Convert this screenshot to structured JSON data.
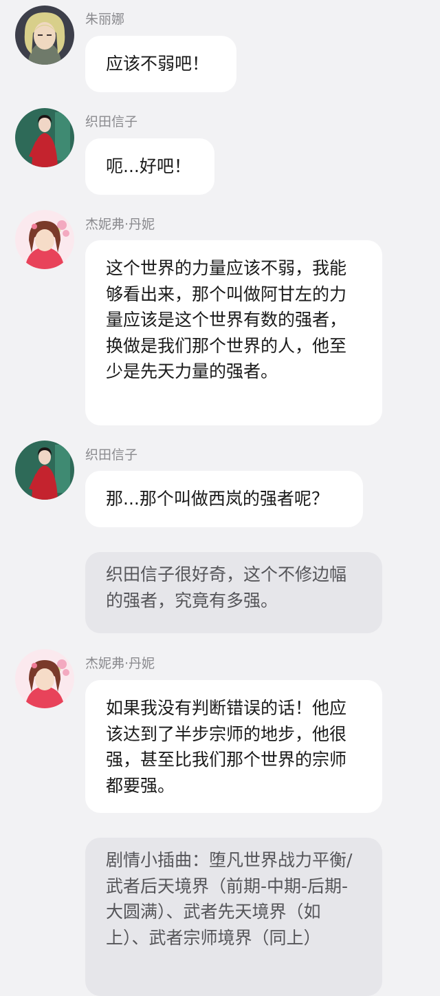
{
  "messages": [
    {
      "sender": "朱丽娜",
      "avatar": "juliana-avatar",
      "text": "应该不弱吧！"
    },
    {
      "sender": "织田信子",
      "avatar": "oda-nobuko-avatar",
      "text": "呃...好吧！"
    },
    {
      "sender": "杰妮弗·丹妮",
      "avatar": "jennifer-danny-avatar",
      "text": "这个世界的力量应该不弱，我能够看出来，那个叫做阿甘左的力量应该是这个世界有数的强者，换做是我们那个世界的人，他至少是先天力量的强者。"
    },
    {
      "sender": "织田信子",
      "avatar": "oda-nobuko-avatar",
      "text": "那...那个叫做西岚的强者呢？"
    },
    {
      "narration": "织田信子很好奇，这个不修边幅的强者，究竟有多强。"
    },
    {
      "sender": "杰妮弗·丹妮",
      "avatar": "jennifer-danny-avatar",
      "text": "如果我没有判断错误的话！他应该达到了半步宗师的地步，他很强，甚至比我们那个世界的宗师都要强。"
    },
    {
      "narration": "剧情小插曲：堕凡世界战力平衡/武者后天境界（前期-中期-后期-大圆满）、武者先天境界（如上）、武者宗师境界（同上）"
    }
  ]
}
